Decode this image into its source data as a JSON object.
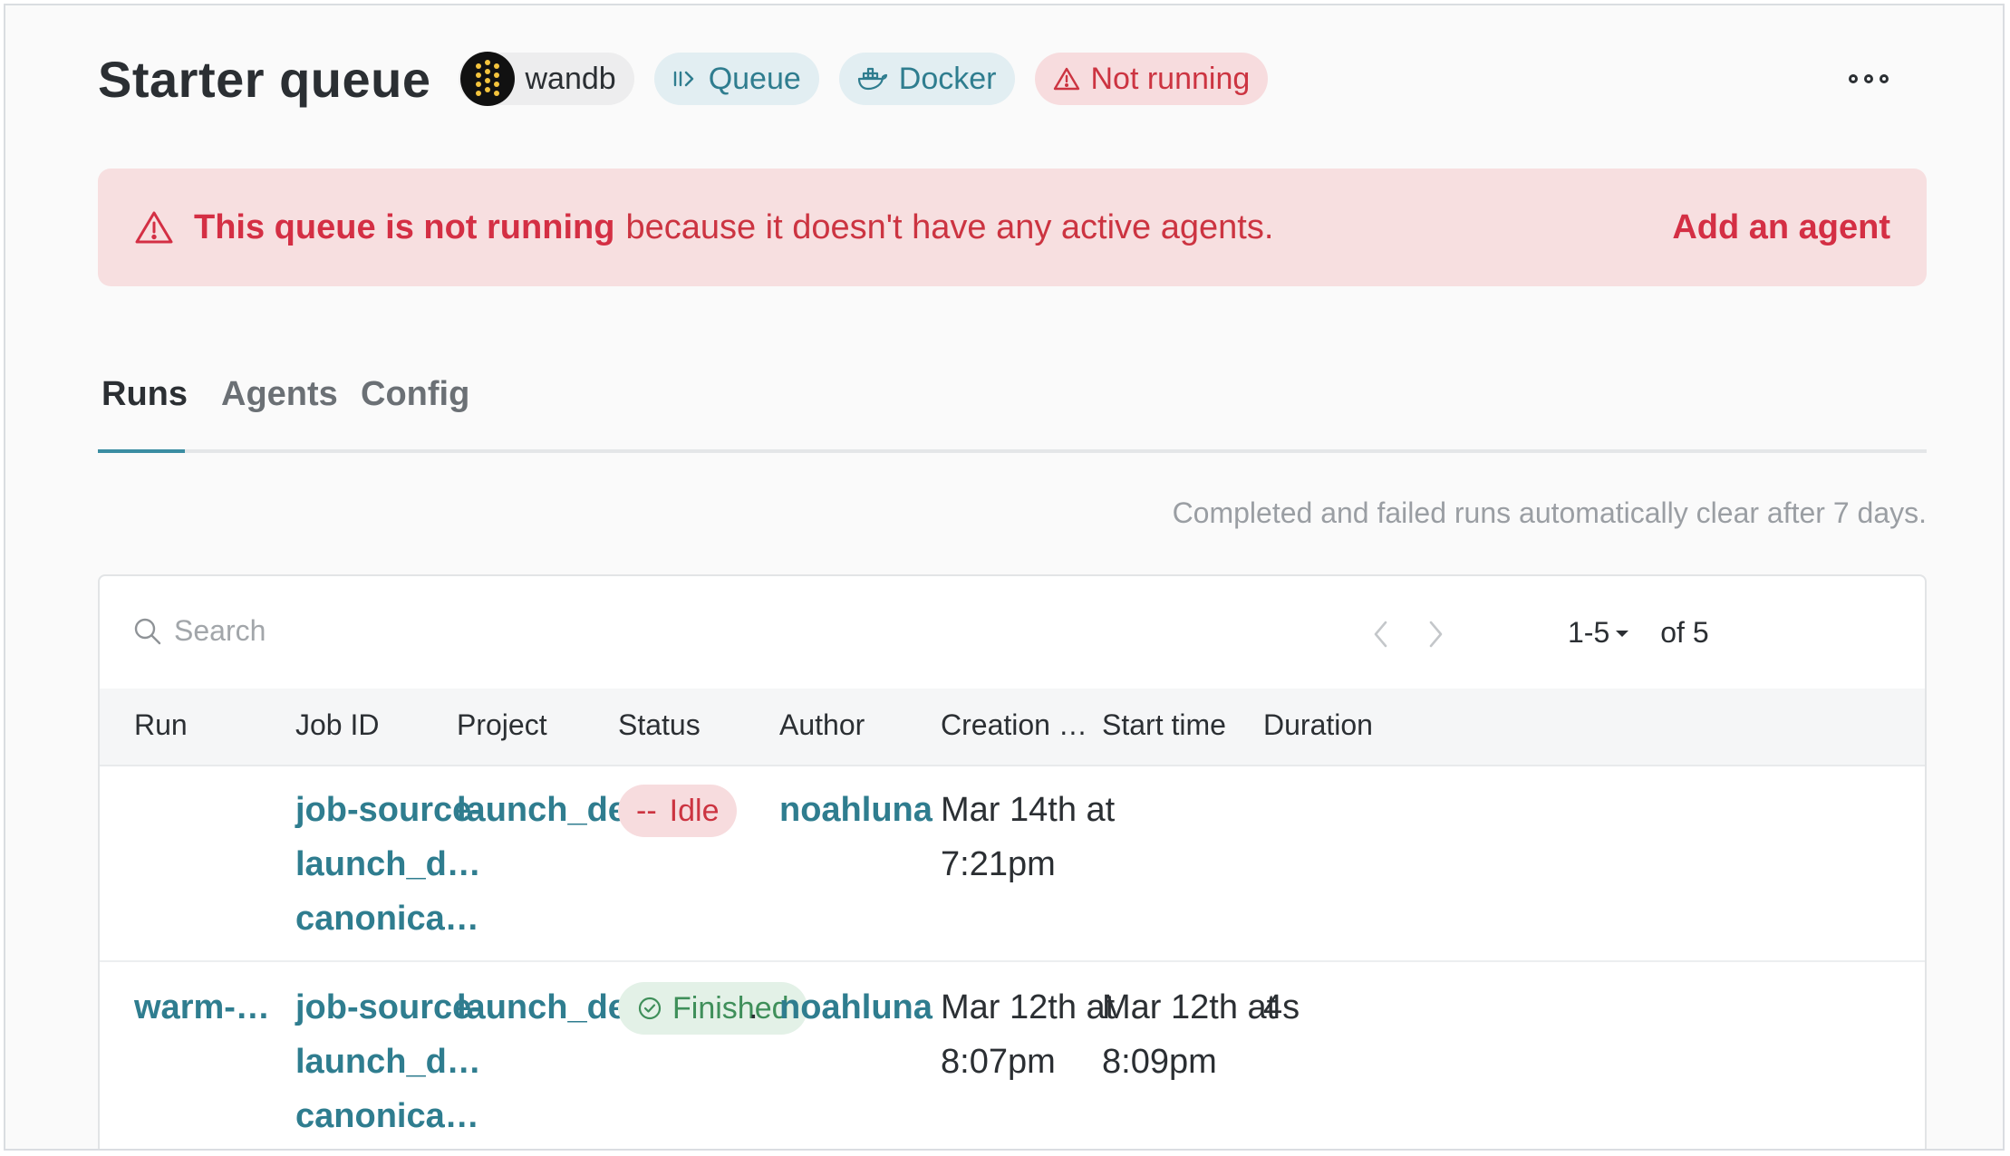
{
  "header": {
    "title": "Starter queue",
    "entity": "wandb",
    "tags": {
      "queue": "Queue",
      "resource": "Docker",
      "state": "Not running"
    },
    "more_icon": "more-horizontal-icon"
  },
  "banner": {
    "strong": "This queue is not running",
    "text": "because it doesn't have any active agents.",
    "action": "Add an agent",
    "icon": "warning-icon"
  },
  "tabs": [
    {
      "label": "Runs",
      "active": true
    },
    {
      "label": "Agents",
      "active": false
    },
    {
      "label": "Config",
      "active": false
    }
  ],
  "retention_note": "Completed and failed runs automatically clear after 7 days.",
  "table": {
    "search": {
      "placeholder": "Search"
    },
    "pagination": {
      "range": "1-5",
      "total": "of 5"
    },
    "columns": [
      "Run",
      "Job ID",
      "Project",
      "Status",
      "Author",
      "Creation dat…",
      "Start time",
      "Duration"
    ],
    "rows": [
      {
        "run": "",
        "job_id": [
          "job-source-",
          "launch_d…",
          "canonica…"
        ],
        "project": "launch_dem",
        "status": "Idle",
        "status_prefix": "--",
        "author": "noahluna",
        "created": [
          "Mar 14th at",
          "7:21pm"
        ],
        "start": [
          "",
          ""
        ],
        "duration": ""
      },
      {
        "run": "warm-po…",
        "job_id": [
          "job-source-",
          "launch_d…",
          "canonica…"
        ],
        "project": "launch_dem",
        "status": "Finished",
        "status_overflow": ".",
        "author": "noahluna",
        "created": [
          "Mar 12th at",
          "8:07pm"
        ],
        "start": [
          "Mar 12th at",
          "8:09pm"
        ],
        "duration": "4s"
      }
    ]
  },
  "colors": {
    "accent": "#2f7d8f",
    "danger": "#d42f44",
    "danger_bg": "#f7dfe0",
    "success": "#3f8f5a",
    "success_bg": "#e3f1e7"
  }
}
